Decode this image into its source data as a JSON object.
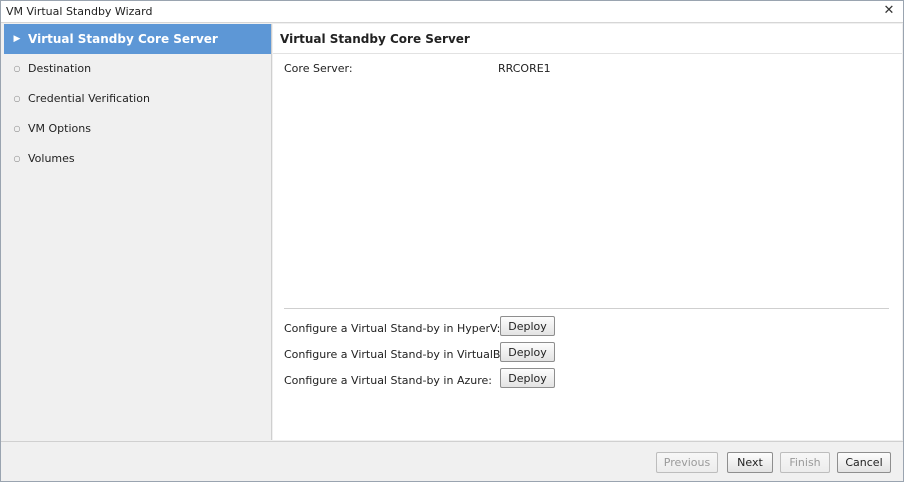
{
  "window": {
    "title": "VM Virtual Standby Wizard",
    "close_icon": "close-icon"
  },
  "sidebar": {
    "items": [
      {
        "label": "Virtual Standby Core Server",
        "active": true
      },
      {
        "label": "Destination",
        "active": false
      },
      {
        "label": "Credential Verification",
        "active": false
      },
      {
        "label": "VM Options",
        "active": false
      },
      {
        "label": "Volumes",
        "active": false
      }
    ],
    "active_marker": "▶",
    "inactive_marker": "○",
    "active_color": "#5d97d6"
  },
  "main": {
    "header": "Virtual Standby Core Server",
    "core_server_label": "Core Server:",
    "core_server_value": "RRCORE1",
    "deploy_rows": [
      {
        "label": "Configure a Virtual Stand-by in HyperV:",
        "button": "Deploy"
      },
      {
        "label": "Configure a Virtual Stand-by in VirtualBox:",
        "button": "Deploy"
      },
      {
        "label": "Configure a Virtual Stand-by in Azure:",
        "button": "Deploy"
      }
    ]
  },
  "footer": {
    "previous": "Previous",
    "next": "Next",
    "finish": "Finish",
    "cancel": "Cancel"
  }
}
